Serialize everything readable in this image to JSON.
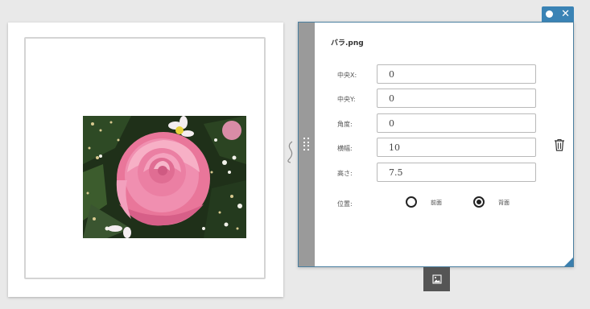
{
  "panel": {
    "title": "バラ.png",
    "fields": [
      {
        "label": "中央X:",
        "value": "0"
      },
      {
        "label": "中央Y:",
        "value": "0"
      },
      {
        "label": "角度:",
        "value": "0"
      },
      {
        "label": "横幅:",
        "value": "10"
      },
      {
        "label": "高さ:",
        "value": "7.5"
      }
    ],
    "position": {
      "label": "位置:",
      "options": [
        {
          "label": "前面",
          "checked": false
        },
        {
          "label": "背面",
          "checked": true
        }
      ]
    }
  },
  "icons": {
    "drag_handle": "grip-icon",
    "delete": "trash-icon",
    "toolbar_dot": "circle-icon",
    "toolbar_close": "close-icon",
    "image_button": "image-icon",
    "connector": "squiggle-connector"
  },
  "colors": {
    "accent": "#3a83b5",
    "handle": "#9a9a9a",
    "image_button": "#555555"
  }
}
